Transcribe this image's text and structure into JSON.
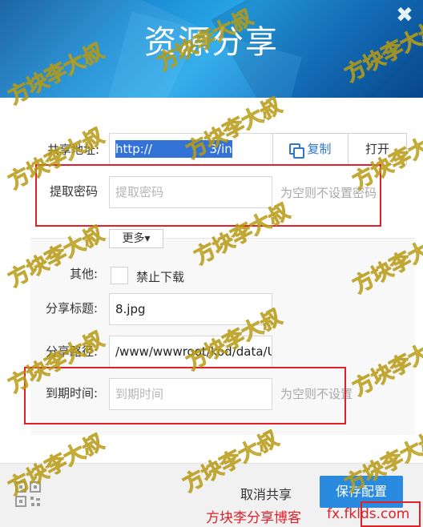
{
  "dialog": {
    "title": "资源分享",
    "close_glyph": "✖"
  },
  "share": {
    "address_label": "共享地址:",
    "address_value": "http://",
    "address_value_tail": "3/in",
    "copy_label": "复制",
    "open_label": "打开",
    "password_label": "提取密码",
    "password_placeholder": "提取密码",
    "password_hint": "为空则不设置密码",
    "more_label": "更多▾"
  },
  "more": {
    "other_label": "其他:",
    "no_download_label": "禁止下载",
    "title_label": "分享标题:",
    "title_value": "8.jpg",
    "path_label": "分享路径:",
    "path_value": "/www/wwwroot/kod/data/U",
    "expire_label": "到期时间:",
    "expire_placeholder": "到期时间",
    "expire_hint": "为空则不设置"
  },
  "footer": {
    "cancel_share": "取消共享",
    "save_config": "保存配置",
    "blog_name": "方块李分享博客",
    "blog_url": "fx.fklds.com"
  },
  "watermark": "方块李大叔",
  "colors": {
    "accent": "#2a8ae0",
    "annotation_red": "#e2202a",
    "watermark_yellow": "#f6ef4a"
  },
  "icons": {
    "close": "close-icon",
    "copy": "copy-icon",
    "qr": "qr-code-icon"
  }
}
